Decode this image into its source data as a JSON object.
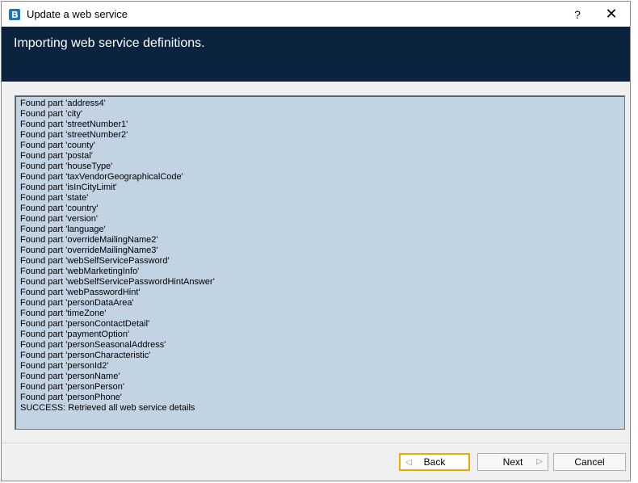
{
  "window": {
    "title": "Update a web service",
    "help_label": "?",
    "close_label": "✕"
  },
  "banner": {
    "heading": "Importing web service definitions."
  },
  "log": {
    "lines": [
      "Found part 'address4'",
      "Found part 'city'",
      "Found part 'streetNumber1'",
      "Found part 'streetNumber2'",
      "Found part 'county'",
      "Found part 'postal'",
      "Found part 'houseType'",
      "Found part 'taxVendorGeographicalCode'",
      "Found part 'isInCityLimit'",
      "Found part 'state'",
      "Found part 'country'",
      "Found part 'version'",
      "Found part 'language'",
      "Found part 'overrideMailingName2'",
      "Found part 'overrideMailingName3'",
      "Found part 'webSelfServicePassword'",
      "Found part 'webMarketingInfo'",
      "Found part 'webSelfServicePasswordHintAnswer'",
      "Found part 'webPasswordHint'",
      "Found part 'personDataArea'",
      "Found part 'timeZone'",
      "Found part 'personContactDetail'",
      "Found part 'paymentOption'",
      "Found part 'personSeasonalAddress'",
      "Found part 'personCharacteristic'",
      "Found part 'personId2'",
      "Found part 'personName'",
      "Found part 'personPerson'",
      "Found part 'personPhone'",
      "SUCCESS: Retrieved all web service details"
    ]
  },
  "buttons": {
    "back": "Back",
    "next": "Next",
    "cancel": "Cancel",
    "back_arrow": "◁",
    "next_arrow": "▷"
  },
  "colors": {
    "banner": "#0c2340",
    "log_background": "#c2d3e3",
    "focus_outline": "#f0a800"
  }
}
